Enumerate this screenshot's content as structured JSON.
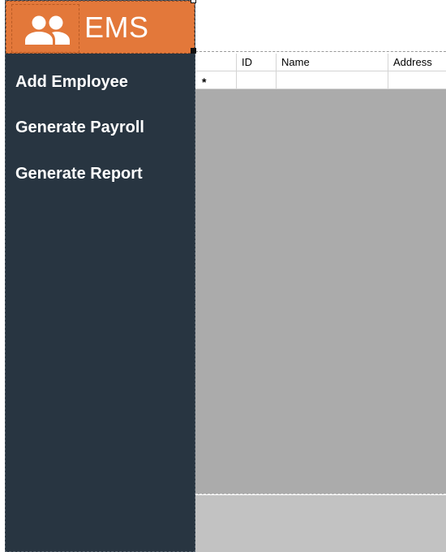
{
  "sidebar": {
    "logo": {
      "text": "EMS",
      "icon": "people-icon"
    },
    "nav": [
      {
        "label": "Add Employee"
      },
      {
        "label": "Generate Payroll"
      },
      {
        "label": "Generate Report"
      }
    ]
  },
  "grid": {
    "columns": [
      "",
      "ID",
      "Name",
      "Address"
    ],
    "new_row_marker": "*"
  },
  "colors": {
    "sidebar": "#283541",
    "logo_panel": "#e3783a",
    "grid_background": "#ababab",
    "bottom_panel": "#c2c2c2"
  }
}
